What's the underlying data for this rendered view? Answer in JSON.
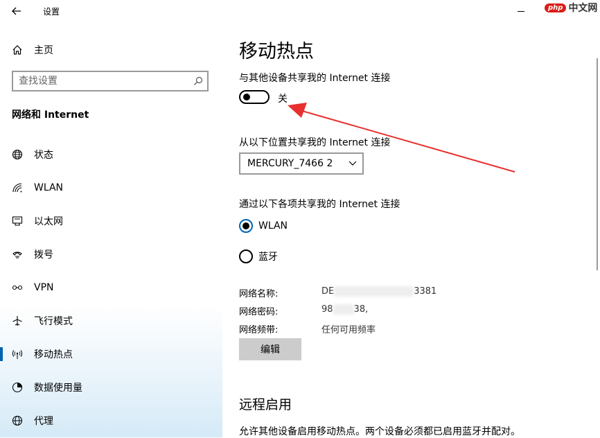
{
  "window": {
    "title": "设置"
  },
  "sidebar": {
    "home_label": "主页",
    "search_placeholder": "查找设置",
    "section_title": "网络和 Internet",
    "items": [
      {
        "label": "状态",
        "icon": "globe-icon"
      },
      {
        "label": "WLAN",
        "icon": "wifi-icon"
      },
      {
        "label": "以太网",
        "icon": "ethernet-icon"
      },
      {
        "label": "拨号",
        "icon": "dialup-icon"
      },
      {
        "label": "VPN",
        "icon": "vpn-icon"
      },
      {
        "label": "飞行模式",
        "icon": "airplane-icon"
      },
      {
        "label": "移动热点",
        "icon": "hotspot-icon",
        "active": true
      },
      {
        "label": "数据使用量",
        "icon": "data-usage-icon"
      },
      {
        "label": "代理",
        "icon": "globe-icon"
      }
    ]
  },
  "watermark": {
    "badge": "php",
    "text": "中文网"
  },
  "main": {
    "title": "移动热点",
    "share_label": "与其他设备共享我的 Internet 连接",
    "toggle_state": "关",
    "share_from_label": "从以下位置共享我的 Internet 连接",
    "share_from_value": "MERCURY_7466 2",
    "share_over_label": "通过以下各项共享我的 Internet 连接",
    "radio_options": [
      {
        "label": "WLAN",
        "checked": true
      },
      {
        "label": "蓝牙",
        "checked": false
      }
    ],
    "info": {
      "name_key": "网络名称:",
      "name_prefix": "DE",
      "name_suffix": "3381",
      "password_key": "网络密码:",
      "password_prefix": "98",
      "password_suffix": "38,",
      "band_key": "网络频带:",
      "band_value": "任何可用频率"
    },
    "edit_label": "编辑",
    "remote_heading": "远程启用",
    "remote_desc": "允许其他设备启用移动热点。两个设备必须都已启用蓝牙并配对。"
  },
  "colors": {
    "accent": "#0063b1",
    "annotation": "#e8312e"
  }
}
